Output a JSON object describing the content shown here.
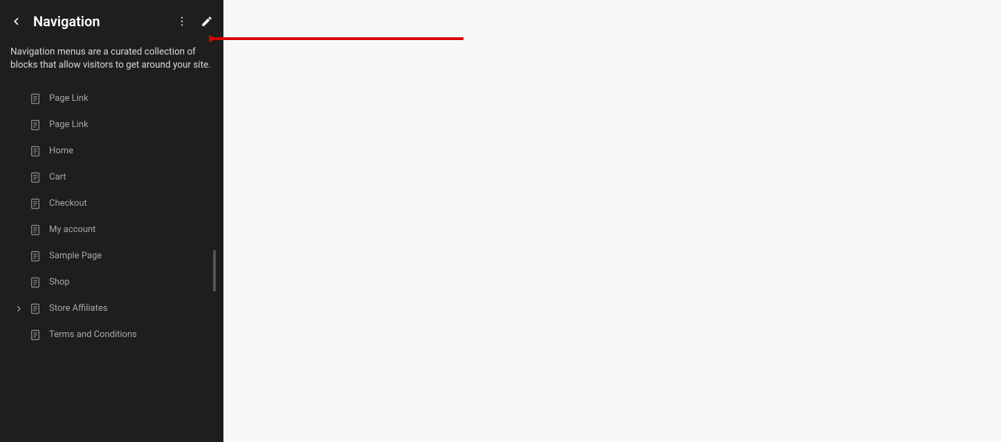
{
  "sidebar": {
    "title": "Navigation",
    "description": "Navigation menus are a curated collection of blocks that allow visitors to get around your site.",
    "items": [
      {
        "label": "Page Link",
        "hasChildren": false
      },
      {
        "label": "Page Link",
        "hasChildren": false
      },
      {
        "label": "Home",
        "hasChildren": false
      },
      {
        "label": "Cart",
        "hasChildren": false
      },
      {
        "label": "Checkout",
        "hasChildren": false
      },
      {
        "label": "My account",
        "hasChildren": false
      },
      {
        "label": "Sample Page",
        "hasChildren": false
      },
      {
        "label": "Shop",
        "hasChildren": false
      },
      {
        "label": "Store Affiliates",
        "hasChildren": true
      },
      {
        "label": "Terms and Conditions",
        "hasChildren": false
      }
    ]
  },
  "annotation": {
    "arrowColor": "#d90000"
  }
}
